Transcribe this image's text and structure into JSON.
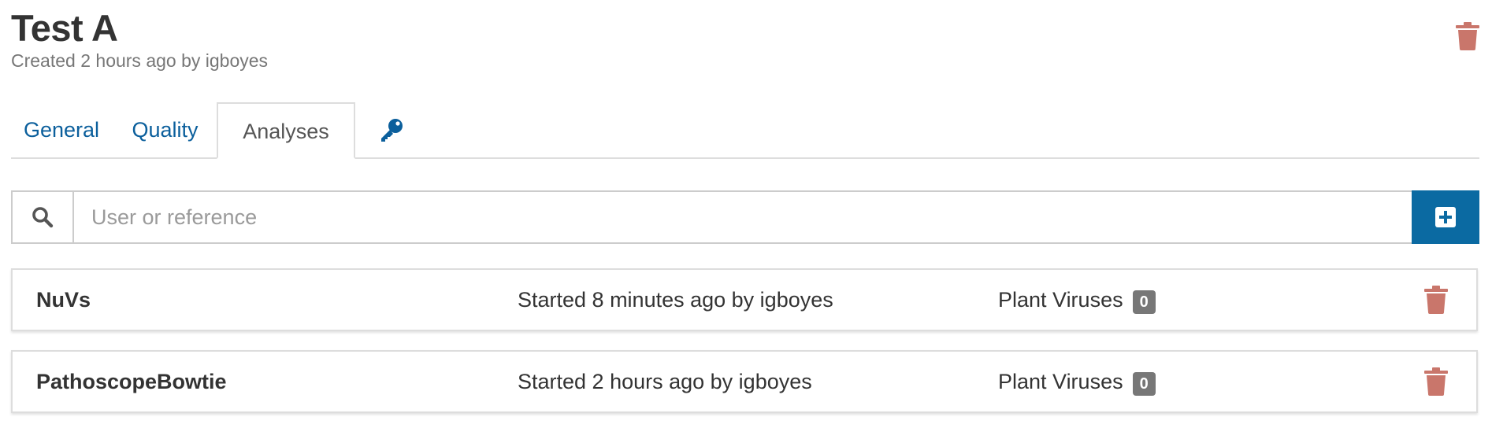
{
  "sample": {
    "title": "Test A",
    "subtitle": "Created 2 hours ago by igboyes"
  },
  "tabs": [
    {
      "label": "General",
      "active": false
    },
    {
      "label": "Quality",
      "active": false
    },
    {
      "label": "Analyses",
      "active": true
    },
    {
      "icon": "key-icon",
      "active": false
    }
  ],
  "search": {
    "placeholder": "User or reference",
    "value": ""
  },
  "analyses": [
    {
      "name": "NuVs",
      "created": "Started 8 minutes ago by igboyes",
      "reference": "Plant Viruses",
      "count": "0"
    },
    {
      "name": "PathoscopeBowtie",
      "created": "Started 2 hours ago by igboyes",
      "reference": "Plant Viruses",
      "count": "0"
    }
  ],
  "icons": {
    "trash": "trash-icon",
    "search": "search-icon",
    "create": "plus-square-icon",
    "key": "key-icon"
  },
  "colors": {
    "primary": "#0b6aa2",
    "link": "#0b5f9c",
    "danger": "#c9766b",
    "badge": "#777777"
  }
}
